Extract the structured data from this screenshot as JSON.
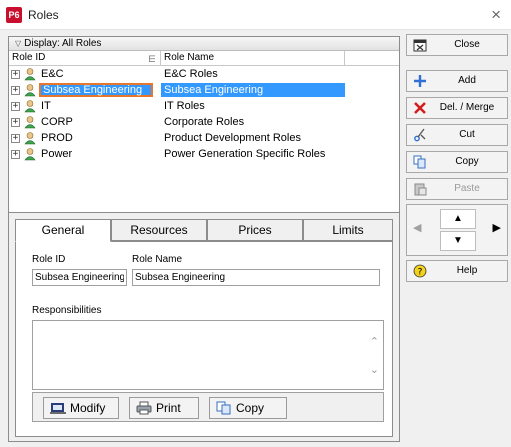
{
  "window": {
    "app_icon_text": "P6",
    "title": "Roles",
    "close_glyph": "×"
  },
  "list": {
    "display_label": "Display: All Roles",
    "columns": [
      "Role ID",
      "Role Name"
    ],
    "rows": [
      {
        "id": "E&C",
        "name": "E&C Roles",
        "selected": false
      },
      {
        "id": "Subsea Engineering",
        "name": "Subsea Engineering",
        "selected": true
      },
      {
        "id": "IT",
        "name": "IT Roles",
        "selected": false
      },
      {
        "id": "CORP",
        "name": "Corporate Roles",
        "selected": false
      },
      {
        "id": "PROD",
        "name": "Product Development Roles",
        "selected": false
      },
      {
        "id": "Power",
        "name": "Power Generation Specific Roles",
        "selected": false
      }
    ]
  },
  "tabs": [
    "General",
    "Resources",
    "Prices",
    "Limits"
  ],
  "general": {
    "role_id_label": "Role ID",
    "role_id_value": "Subsea Engineering",
    "role_name_label": "Role Name",
    "role_name_value": "Subsea Engineering",
    "responsibilities_label": "Responsibilities"
  },
  "bottom_buttons": {
    "modify": "Modify",
    "print": "Print",
    "copy": "Copy"
  },
  "side_buttons": {
    "close": "Close",
    "add": "Add",
    "delete_merge": "Del. / Merge",
    "cut": "Cut",
    "copy": "Copy",
    "paste": "Paste",
    "help": "Help"
  },
  "colors": {
    "selection": "#3399ff",
    "focus_outline": "#e8772e",
    "app_icon": "#c8102e"
  }
}
